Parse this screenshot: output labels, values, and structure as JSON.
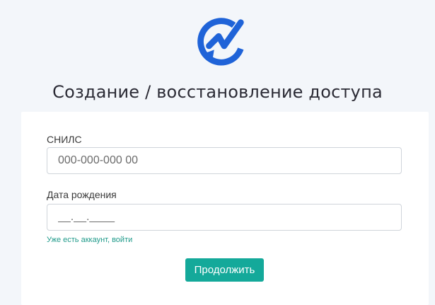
{
  "header": {
    "logo_icon": "check-refresh-logo-icon",
    "title": "Создание / восстановление доступа"
  },
  "form": {
    "snils": {
      "label": "СНИЛС",
      "value": "",
      "placeholder": "000-000-000 00"
    },
    "birth_date": {
      "label": "Дата рождения",
      "value": "",
      "placeholder": "__.__.____"
    },
    "login_link": "Уже есть аккаунт, войти",
    "continue_label": "Продолжить"
  },
  "colors": {
    "background": "#f3f6fa",
    "logo_blue": "#1f63d8",
    "accent": "#14a99a",
    "link": "#1f9a8a",
    "title_text": "#2b2b35"
  }
}
